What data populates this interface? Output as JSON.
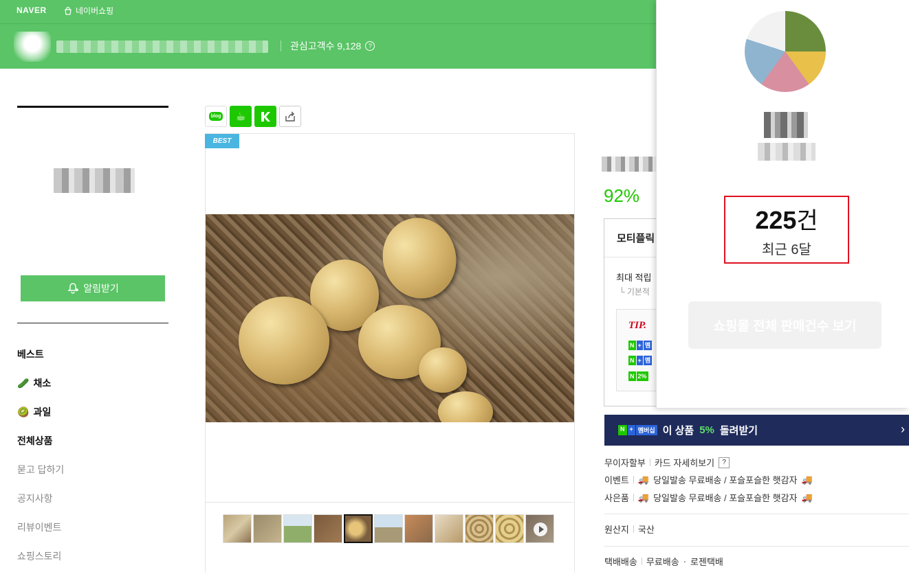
{
  "header": {
    "brand": "NAVER",
    "shopping_label": "네이버쇼핑",
    "followers_label": "관심고객수 9,128",
    "help_mark": "?"
  },
  "sidebar": {
    "alarm_label": "알림받기",
    "menu": [
      {
        "label": "베스트",
        "icon": ""
      },
      {
        "label": "채소",
        "icon": "🥒"
      },
      {
        "label": "과일",
        "icon": "🥝"
      },
      {
        "label": "전체상품",
        "icon": ""
      },
      {
        "label": "묻고 답하기",
        "icon": ""
      },
      {
        "label": "공지사항",
        "icon": ""
      },
      {
        "label": "리뷰이벤트",
        "icon": ""
      },
      {
        "label": "쇼핑스토리",
        "icon": ""
      }
    ]
  },
  "share": {
    "blog_label": "blog"
  },
  "product": {
    "best_badge": "BEST",
    "discount": "92%",
    "benefit_title": "모티플릭",
    "benefit_max": "최대 적립",
    "benefit_sub": "└ 기본적",
    "tip_label": "TIP.",
    "tip_badges": [
      [
        "N",
        "+",
        "멤"
      ],
      [
        "N",
        "+",
        "멤"
      ],
      [
        "N",
        "2%"
      ]
    ],
    "membership": {
      "badge_n": "N",
      "badge_plus": "+",
      "badge_text": "멤버십",
      "text_before": "이 상품",
      "percent": "5%",
      "text_after": "돌려받기",
      "chevron": "›"
    },
    "installment_label": "무이자할부",
    "card_detail_label": "카드 자세히보기",
    "event_label": "이벤트",
    "event_text": "당일발송 무료배송 / 포슬포슬한 햇감자",
    "gift_label": "사은품",
    "gift_text": "당일발송 무료배송 / 포슬포슬한 햇감자",
    "origin_label": "원산지",
    "origin_value": "국산",
    "delivery_label": "택배배송",
    "delivery_value": "무료배송",
    "courier": "로젠택배"
  },
  "popup": {
    "sales_number": "225",
    "sales_unit": "건",
    "sales_period": "최근 6달",
    "total_button": "쇼핑몰 전체 판매건수 보기"
  },
  "colors": {
    "naver_green": "#5ac466",
    "accent_green": "#1ec800",
    "membership_navy": "#1f2b5b",
    "highlight_red": "#e0101f",
    "best_blue": "#4ab5e0"
  }
}
